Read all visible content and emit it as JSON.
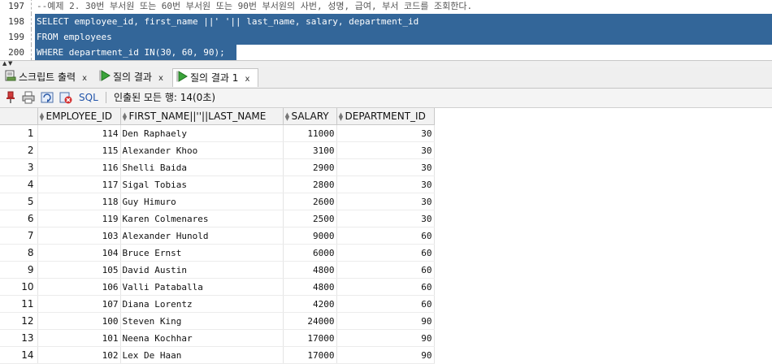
{
  "editor": {
    "lines": [
      {
        "num": "197",
        "text": "--예제 2. 30번 부서원 또는 60번 부서원 또는 90번 부서원의 사번, 성명, 급여, 부서 코드를 조회한다."
      },
      {
        "num": "198",
        "text": "SELECT employee_id, first_name ||' '|| last_name, salary, department_id"
      },
      {
        "num": "199",
        "text": "FROM employees"
      },
      {
        "num": "200",
        "text": "WHERE department_id IN(30, 60, 90);"
      }
    ],
    "selection_color": "#336699"
  },
  "tabs": [
    {
      "label": "스크립트 출력",
      "icon": "script-output-icon",
      "close": "x"
    },
    {
      "label": "질의 결과",
      "icon": "run-query-icon",
      "close": "x"
    },
    {
      "label": "질의 결과 1",
      "icon": "run-query-icon",
      "close": "x",
      "active": true
    }
  ],
  "toolbar": {
    "icons": [
      "pin-icon",
      "print-icon",
      "refresh-icon",
      "cancel-icon"
    ],
    "sql_label": "SQL",
    "fetch_status": "인출된 모든 행: 14(0초)"
  },
  "grid": {
    "columns": [
      "EMPLOYEE_ID",
      "FIRST_NAME||''||LAST_NAME",
      "SALARY",
      "DEPARTMENT_ID"
    ],
    "rows": [
      [
        "1",
        "114",
        "Den Raphaely",
        "11000",
        "30"
      ],
      [
        "2",
        "115",
        "Alexander Khoo",
        "3100",
        "30"
      ],
      [
        "3",
        "116",
        "Shelli Baida",
        "2900",
        "30"
      ],
      [
        "4",
        "117",
        "Sigal Tobias",
        "2800",
        "30"
      ],
      [
        "5",
        "118",
        "Guy Himuro",
        "2600",
        "30"
      ],
      [
        "6",
        "119",
        "Karen Colmenares",
        "2500",
        "30"
      ],
      [
        "7",
        "103",
        "Alexander Hunold",
        "9000",
        "60"
      ],
      [
        "8",
        "104",
        "Bruce Ernst",
        "6000",
        "60"
      ],
      [
        "9",
        "105",
        "David Austin",
        "4800",
        "60"
      ],
      [
        "10",
        "106",
        "Valli Pataballa",
        "4800",
        "60"
      ],
      [
        "11",
        "107",
        "Diana Lorentz",
        "4200",
        "60"
      ],
      [
        "12",
        "100",
        "Steven King",
        "24000",
        "90"
      ],
      [
        "13",
        "101",
        "Neena Kochhar",
        "17000",
        "90"
      ],
      [
        "14",
        "102",
        "Lex De Haan",
        "17000",
        "90"
      ]
    ]
  }
}
